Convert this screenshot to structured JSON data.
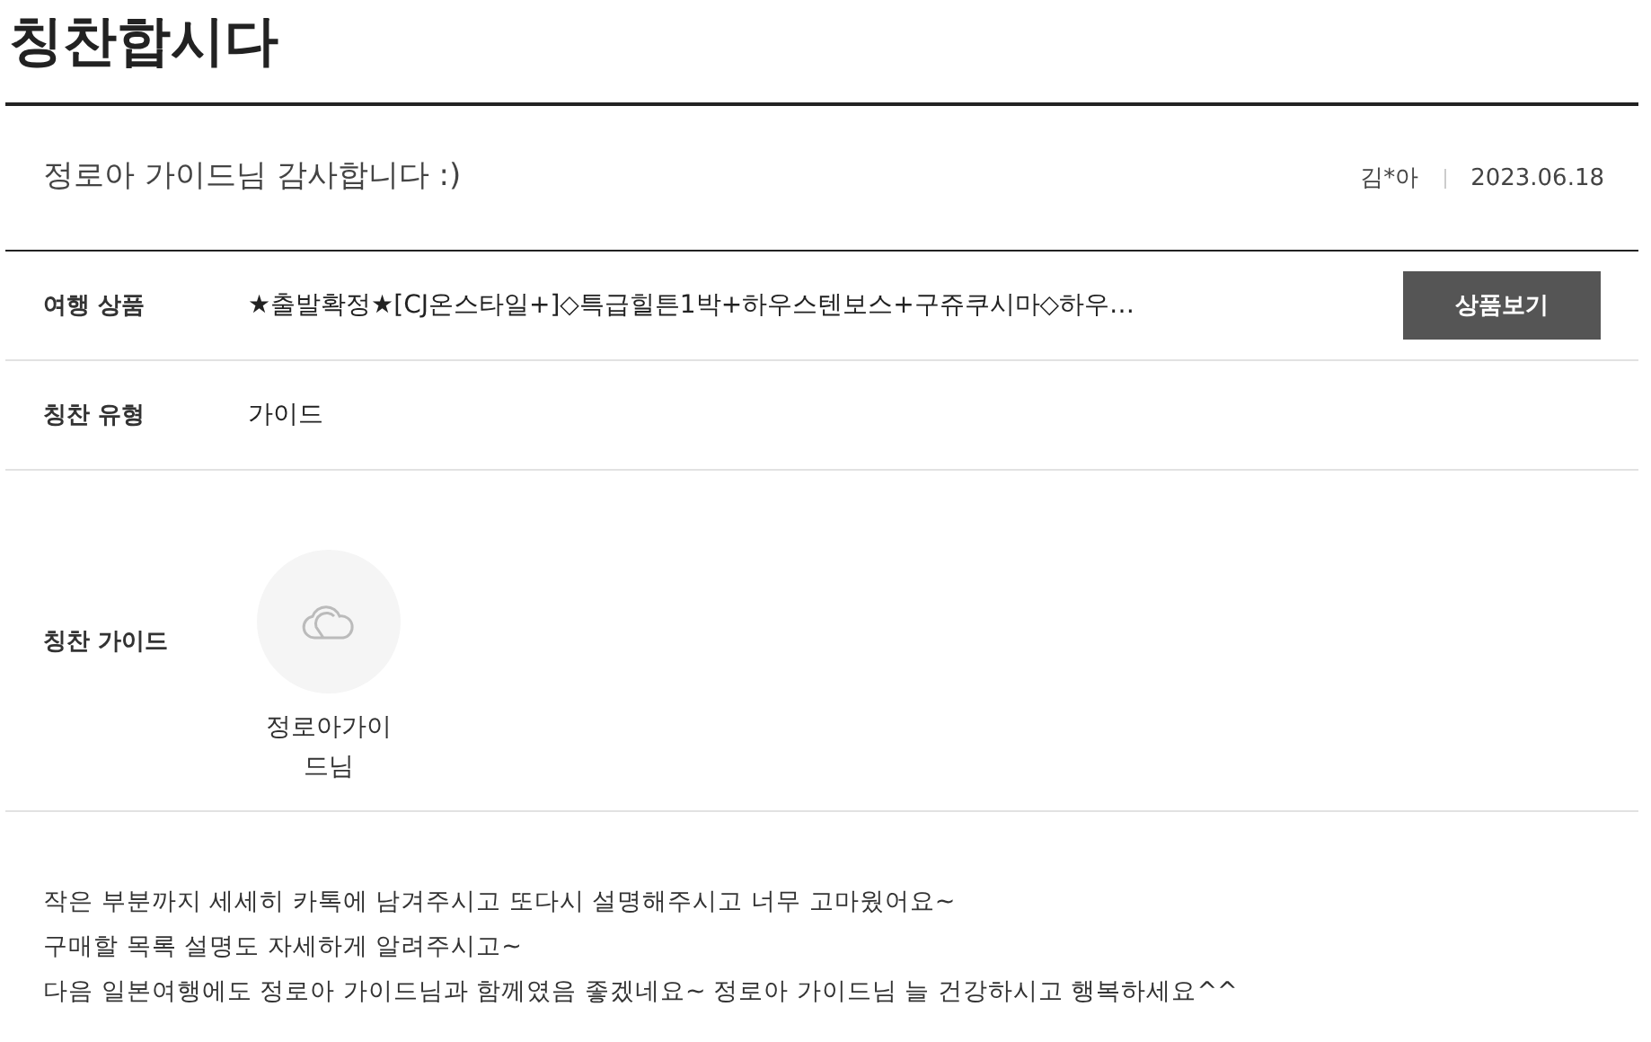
{
  "page_title": "칭찬합시다",
  "post": {
    "title": "정로아 가이드님 감사합니다 :)",
    "author": "김*아",
    "date": "2023.06.18"
  },
  "fields": [
    {
      "kind": "product",
      "label": "여행 상품",
      "value": "★출발확정★[CJ온스타일+]◇특급힐튼1박+하우스텐보스+구쥬쿠시마◇하우…",
      "button": "상품보기"
    },
    {
      "kind": "text",
      "label": "칭찬 유형",
      "value": "가이드"
    },
    {
      "kind": "guide",
      "label": "칭찬 가이드",
      "name": "정로아가이드님"
    }
  ],
  "body": [
    "작은 부분까지 세세히 카톡에 남겨주시고 또다시 설명해주시고 너무 고마웠어요~",
    "구매할 목록 설명도 자세하게 알려주시고~",
    "다음 일본여행에도 정로아 가이드님과 함께였음 좋겠네요~ 정로아 가이드님 늘 건강하시고 행복하세요^^"
  ]
}
